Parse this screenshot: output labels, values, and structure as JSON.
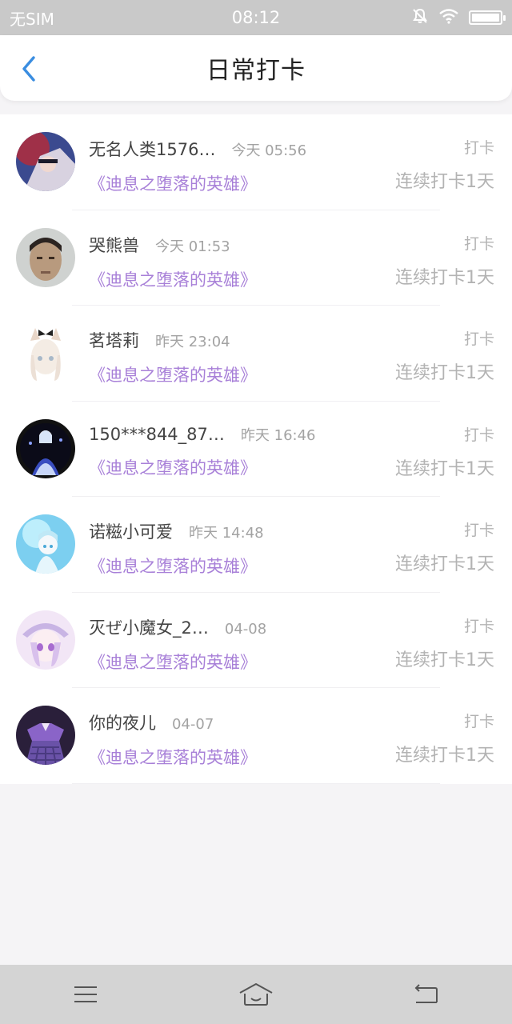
{
  "status_bar": {
    "carrier": "无SIM",
    "time": "08:12",
    "icons": [
      "mute-icon",
      "wifi-icon",
      "battery-icon"
    ]
  },
  "header": {
    "back_icon": "chevron-left-icon",
    "title": "日常打卡"
  },
  "colors": {
    "accent": "#3a8de0",
    "book_title": "#a880d8",
    "muted_text": "#b3b3b3"
  },
  "entries": [
    {
      "name": "无名人类1576…",
      "time": "今天 05:56",
      "book": "《迪息之堕落的英雄》",
      "label": "打卡",
      "streak": "连续打卡1天"
    },
    {
      "name": "哭熊兽",
      "time": "今天 01:53",
      "book": "《迪息之堕落的英雄》",
      "label": "打卡",
      "streak": "连续打卡1天"
    },
    {
      "name": "茗塔莉",
      "time": "昨天 23:04",
      "book": "《迪息之堕落的英雄》",
      "label": "打卡",
      "streak": "连续打卡1天"
    },
    {
      "name": "150***844_87…",
      "time": "昨天 16:46",
      "book": "《迪息之堕落的英雄》",
      "label": "打卡",
      "streak": "连续打卡1天"
    },
    {
      "name": "诺糍小可爱",
      "time": "昨天 14:48",
      "book": "《迪息之堕落的英雄》",
      "label": "打卡",
      "streak": "连续打卡1天"
    },
    {
      "name": "灭ぜ小魔女_2…",
      "time": "04-08",
      "book": "《迪息之堕落的英雄》",
      "label": "打卡",
      "streak": "连续打卡1天"
    },
    {
      "name": "你的夜儿",
      "time": "04-07",
      "book": "《迪息之堕落的英雄》",
      "label": "打卡",
      "streak": "连续打卡1天"
    }
  ],
  "nav": {
    "icons": [
      "menu-icon",
      "home-icon",
      "back-icon"
    ]
  }
}
